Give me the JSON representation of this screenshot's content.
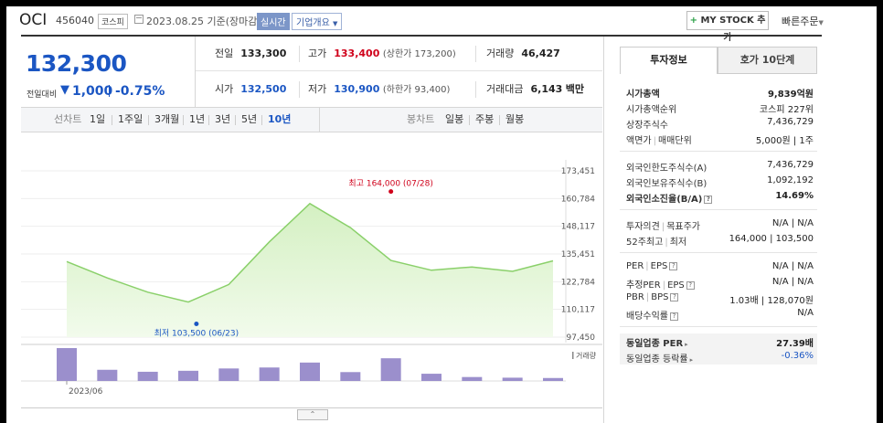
{
  "header": {
    "name": "OCI",
    "code": "456040",
    "market_badge": "코스피",
    "date": "2023.08.25 기준(장마감)",
    "live_label": "실시간",
    "company_info_label": "기업개요",
    "mystock_label": "MY STOCK 추가",
    "quick_order_label": "빠른주문"
  },
  "price": {
    "current": "132,300",
    "change_label": "전일대비",
    "change_arrow": "▼",
    "change_value": "1,000",
    "change_pct": "-0.75%"
  },
  "quote": {
    "prev_label": "전일",
    "prev_value": "133,300",
    "high_label": "고가",
    "high_value": "133,400",
    "upper_limit": "(상한가 173,200)",
    "volume_label": "거래량",
    "volume_value": "46,427",
    "open_label": "시가",
    "open_value": "132,500",
    "low_label": "저가",
    "low_value": "130,900",
    "lower_limit": "(하한가 93,400)",
    "amount_label": "거래대금",
    "amount_value": "6,143",
    "amount_unit": "백만"
  },
  "period_tabs": {
    "line_label": "선차트",
    "line_items": [
      "1일",
      "1주일",
      "3개월",
      "1년",
      "3년",
      "5년",
      "10년"
    ],
    "active_index": 6,
    "candle_label": "봉차트",
    "candle_items": [
      "일봉",
      "주봉",
      "월봉"
    ]
  },
  "chart_data": {
    "type": "area",
    "y_ticks": [
      "173,451",
      "160,784",
      "148,117",
      "135,451",
      "122,784",
      "110,117",
      "97,450"
    ],
    "ylim": [
      97450,
      173451
    ],
    "x_labels": [
      "2023/06"
    ],
    "values": [
      132000,
      124500,
      118000,
      113500,
      121500,
      141000,
      158500,
      147500,
      132500,
      128000,
      129500,
      127500,
      132300
    ],
    "volumes": [
      1.0,
      0.34,
      0.28,
      0.31,
      0.38,
      0.41,
      0.56,
      0.27,
      0.69,
      0.22,
      0.12,
      0.1,
      0.09
    ],
    "high_annotation": "최고 164,000 (07/28)",
    "high_value": 164000,
    "high_index": 8,
    "low_annotation": "최저 103,500 (06/23)",
    "low_value": 103500,
    "low_index": 3.2,
    "volume_label": "거래량",
    "colors": {
      "line": "#8ad06a",
      "fill_top": "#d4f0c2",
      "fill_bottom": "#f2fbec",
      "bar": "#9b8fcc",
      "high": "#d0021b",
      "low": "#1b56c3"
    }
  },
  "right_panel": {
    "tab_invest": "투자정보",
    "tab_quote10": "호가 10단계",
    "group1": [
      {
        "k": "시가총액",
        "v": "9,839억원",
        "bold": true
      },
      {
        "k": "시가총액순위",
        "v": "코스피 227위"
      },
      {
        "k": "상장주식수",
        "v": "7,436,729"
      },
      {
        "k": "액면가 | 매매단위",
        "v": "5,000원 | 1주"
      }
    ],
    "group2": [
      {
        "k": "외국인한도주식수(A)",
        "v": "7,436,729"
      },
      {
        "k": "외국인보유주식수(B)",
        "v": "1,092,192"
      },
      {
        "k": "외국인소진율(B/A)",
        "v": "14.69%",
        "bold": true,
        "help": true
      }
    ],
    "group3": [
      {
        "k": "투자의견 | 목표주가",
        "v": "N/A | N/A"
      },
      {
        "k": "52주최고 | 최저",
        "v": "164,000 | 103,500"
      }
    ],
    "group4": [
      {
        "k": "PER | EPS",
        "v": "N/A | N/A",
        "help": true
      },
      {
        "k": "추정PER | EPS",
        "v": "N/A | N/A",
        "help": true
      },
      {
        "k": "PBR | BPS",
        "v": "1.03배 | 128,070원",
        "help": true
      },
      {
        "k": "배당수익률",
        "v": "N/A",
        "help": true
      }
    ],
    "group5": [
      {
        "k": "동일업종 PER",
        "v": "27.39배",
        "bold": true
      },
      {
        "k": "동일업종 등락률",
        "v": "-0.36%",
        "blue": true
      }
    ],
    "help_glyph": "?",
    "bullet_glyph": "▸"
  },
  "scroll_glyph": "⌃"
}
